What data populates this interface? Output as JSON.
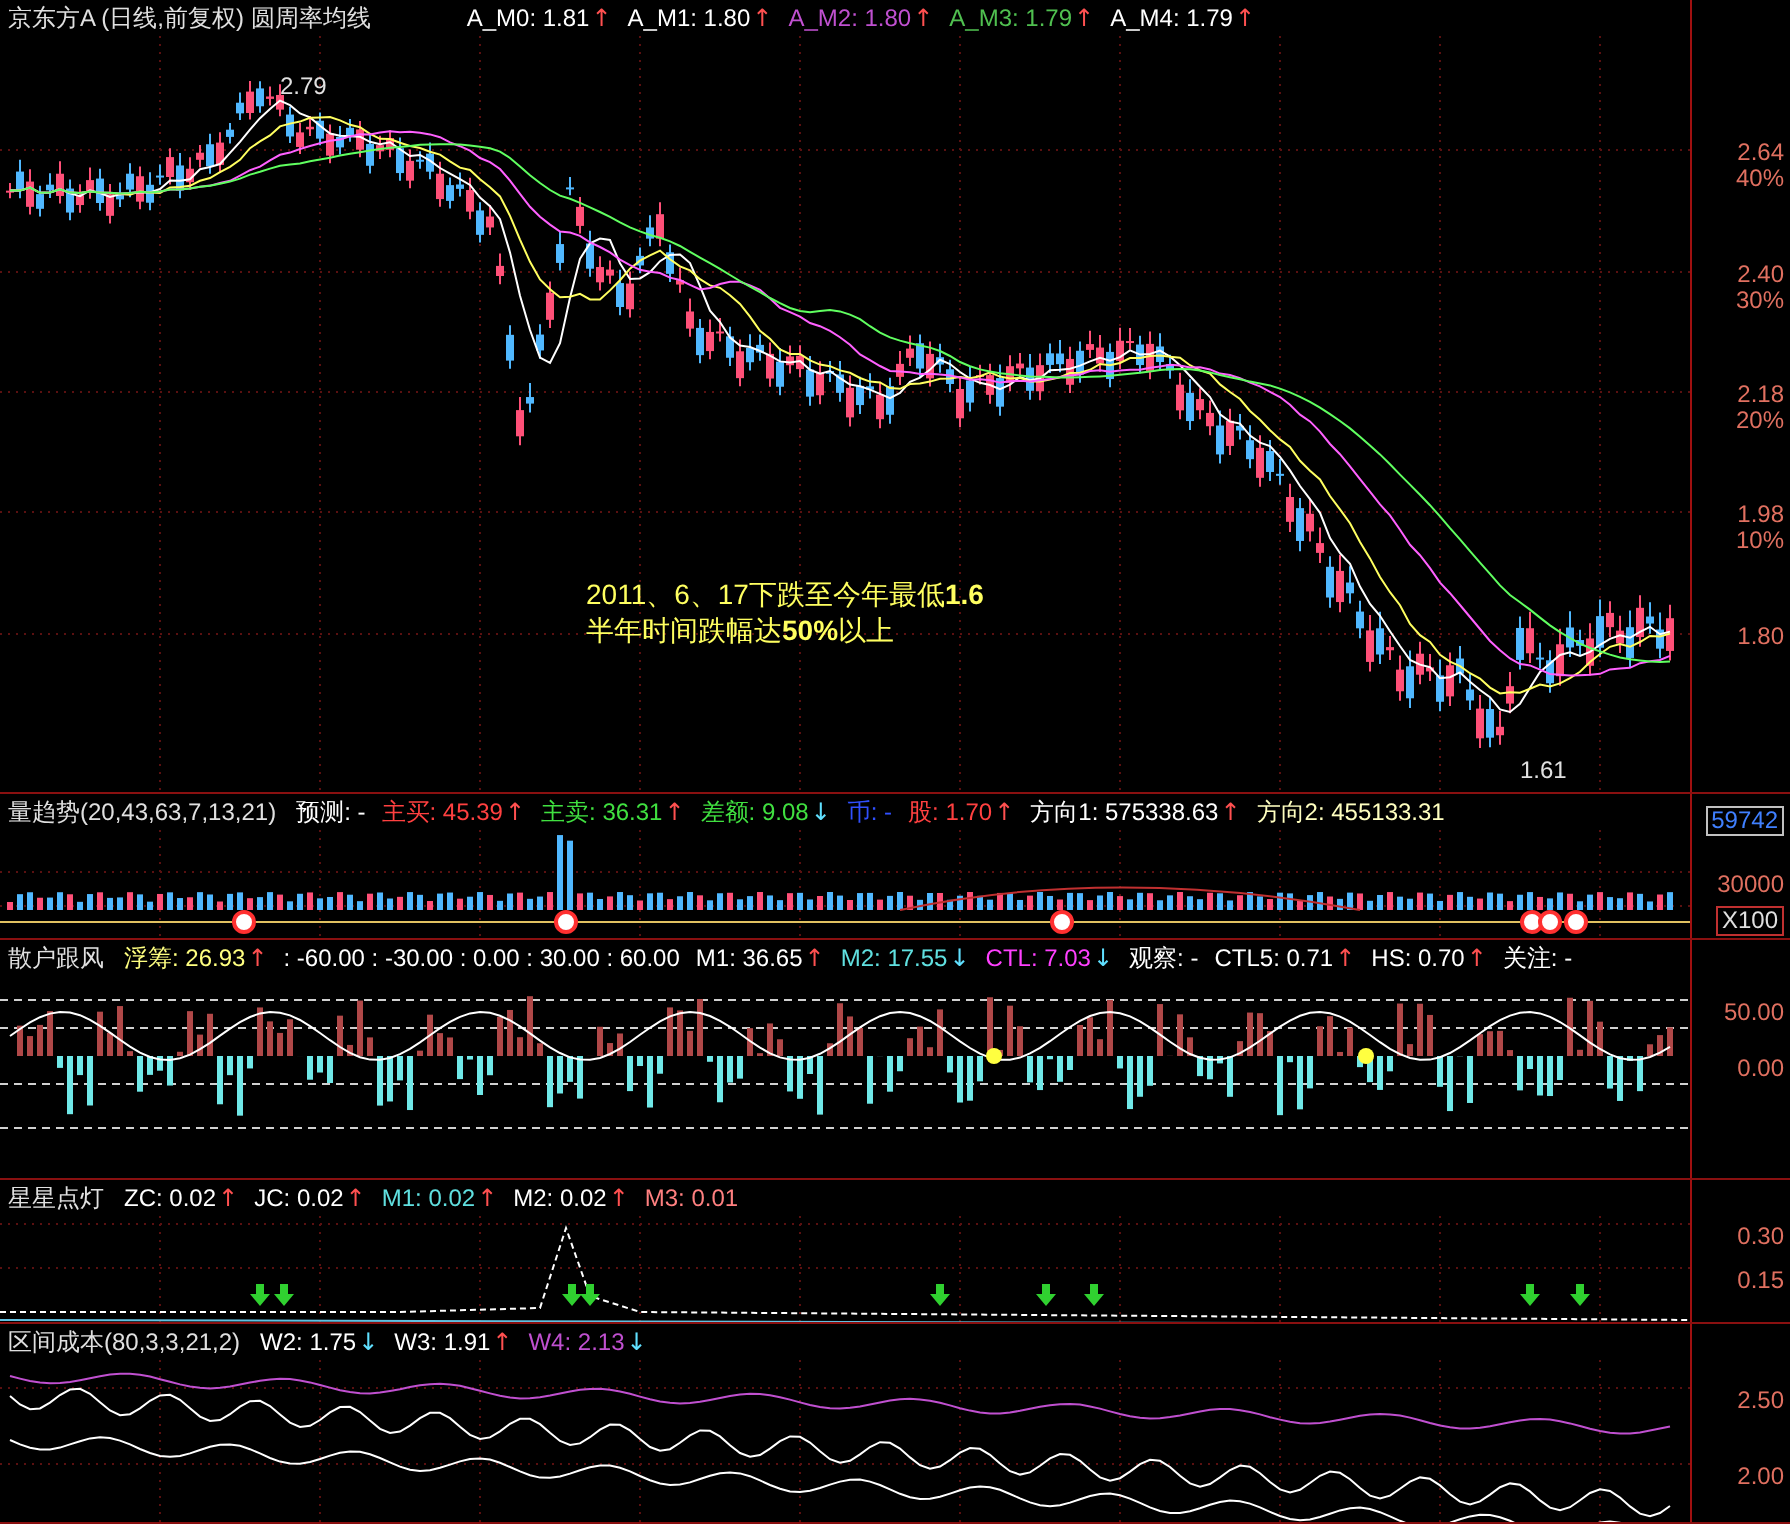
{
  "panels": [
    {
      "kind": "price",
      "title": "京东方A (日线,前复权) 圆周率均线",
      "items": [
        {
          "label": "A_M0:",
          "value": "1.81",
          "color": "#ffffff",
          "arrow": "↑",
          "rising": true
        },
        {
          "label": "A_M1:",
          "value": "1.80",
          "color": "#ffffff",
          "arrow": "↑",
          "rising": true
        },
        {
          "label": "A_M2:",
          "value": "1.80",
          "color": "#c050d0",
          "arrow": "↑",
          "rising": true
        },
        {
          "label": "A_M3:",
          "value": "1.79",
          "color": "#50c050",
          "arrow": "↑",
          "rising": true
        },
        {
          "label": "A_M4:",
          "value": "1.79",
          "color": "#ffffff",
          "arrow": "↑",
          "rising": true
        }
      ],
      "axis": [
        {
          "label": "2.64",
          "sub": "40%",
          "kind": "plain"
        },
        {
          "label": "2.40",
          "sub": "30%",
          "kind": "plain"
        },
        {
          "label": "2.18",
          "sub": "20%",
          "kind": "plain"
        },
        {
          "label": "1.98",
          "sub": "10%",
          "kind": "plain"
        },
        {
          "label": "1.80",
          "kind": "plain"
        }
      ],
      "annotation": [
        "2011、6、17下跌至今年最低**1.6**",
        "半年时间跌幅达**50%**以上"
      ],
      "high_marker": "2.79",
      "low_marker": "1.61"
    },
    {
      "kind": "volume",
      "title": "量趋势(20,43,63,7,13,21)",
      "items": [
        {
          "label": "预测:",
          "value": "-",
          "color": "#ffffff"
        },
        {
          "label": "主买:",
          "value": "45.39",
          "color": "#ff4040",
          "arrow": "↑",
          "rising": true
        },
        {
          "label": "主卖:",
          "value": "36.31",
          "color": "#40e040",
          "arrow": "↑",
          "rising": true
        },
        {
          "label": "差额:",
          "value": "9.08",
          "color": "#40e040",
          "arrow": "↓",
          "rising": false
        },
        {
          "label": "币:",
          "value": "-",
          "color": "#3050ff"
        },
        {
          "label": "股:",
          "value": "1.70",
          "color": "#ff4040",
          "arrow": "↑",
          "rising": true
        },
        {
          "label": "方向1:",
          "value": "575338.63",
          "color": "#ffffff",
          "arrow": "↑",
          "rising": true
        },
        {
          "label": "方向2:",
          "value": "455133.31",
          "color": "#ffffc0"
        }
      ],
      "axis": [
        {
          "label": "59742",
          "kind": "highlight"
        },
        {
          "label": "30000",
          "kind": "plain"
        },
        {
          "label": "X100",
          "kind": "unit"
        }
      ]
    },
    {
      "kind": "sentiment",
      "title": "散户跟风",
      "items": [
        {
          "label": "浮筹:",
          "value": "26.93",
          "color": "#ffff80",
          "arrow": "↑",
          "rising": true
        },
        {
          "value": ": -60.00 : -30.00 : 0.00 : 30.00 : 60.00",
          "color": "#ffffff"
        },
        {
          "label": "M1:",
          "value": "36.65",
          "color": "#ffffff",
          "arrow": "↑",
          "rising": true
        },
        {
          "label": "M2:",
          "value": "17.55",
          "color": "#60e0e0",
          "arrow": "↓",
          "rising": false
        },
        {
          "label": "CTL:",
          "value": "7.03",
          "color": "#ff40ff",
          "arrow": "↓",
          "rising": false
        },
        {
          "label": "观察:",
          "value": "-",
          "color": "#ffffff"
        },
        {
          "label": "CTL5:",
          "value": "0.71",
          "color": "#ffffff",
          "arrow": "↑",
          "rising": true
        },
        {
          "label": "HS:",
          "value": "0.70",
          "color": "#ffffff",
          "arrow": "↑",
          "rising": true
        },
        {
          "label": "关注:",
          "value": "-",
          "color": "#ffffff"
        }
      ],
      "axis": [
        {
          "label": "50.00",
          "kind": "plain"
        },
        {
          "label": "0.00",
          "kind": "plain"
        }
      ]
    },
    {
      "kind": "stars",
      "title": "星星点灯",
      "items": [
        {
          "label": "ZC:",
          "value": "0.02",
          "color": "#ffffff",
          "arrow": "↑",
          "rising": true
        },
        {
          "label": "JC:",
          "value": "0.02",
          "color": "#ffffff",
          "arrow": "↑",
          "rising": true
        },
        {
          "label": "M1:",
          "value": "0.02",
          "color": "#60e0e0",
          "arrow": "↑",
          "rising": true
        },
        {
          "label": "M2:",
          "value": "0.02",
          "color": "#ffffff",
          "arrow": "↑",
          "rising": true
        },
        {
          "label": "M3:",
          "value": "0.01",
          "color": "#ff8080"
        }
      ],
      "axis": [
        {
          "label": "0.30",
          "kind": "plain"
        },
        {
          "label": "0.15",
          "kind": "plain"
        }
      ]
    },
    {
      "kind": "cost",
      "title": "区间成本(80,3,3,21,2)",
      "items": [
        {
          "label": "W2:",
          "value": "1.75",
          "color": "#ffffff",
          "arrow": "↓",
          "rising": false
        },
        {
          "label": "W3:",
          "value": "1.91",
          "color": "#ffffff",
          "arrow": "↑",
          "rising": true
        },
        {
          "label": "W4:",
          "value": "2.13",
          "color": "#c050d0",
          "arrow": "↓",
          "rising": false
        }
      ],
      "axis": [
        {
          "label": "2.50",
          "kind": "plain"
        },
        {
          "label": "2.00",
          "kind": "plain"
        }
      ]
    }
  ]
}
